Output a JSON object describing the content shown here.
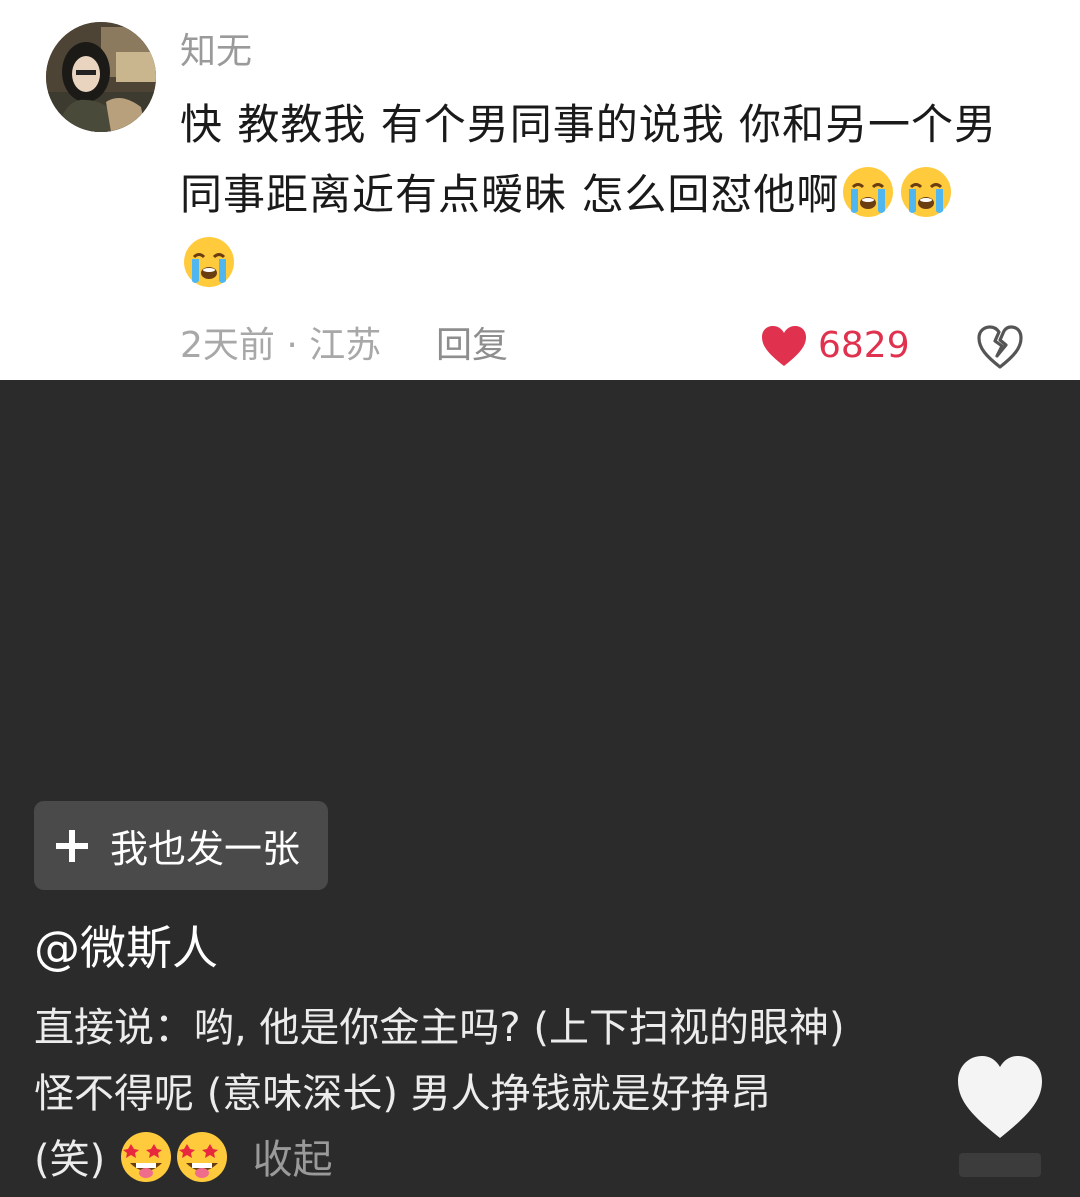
{
  "comment": {
    "username": "知无",
    "text_line1": "快 教教我 有个男同事的说我 你和另一个男",
    "text_line2": "同事距离近有点暧昧 怎么回怼他啊",
    "emoji": "loudly-crying-face-icon",
    "time_location": "2天前 · 江苏",
    "reply_label": "回复",
    "like_count": "6829",
    "like_color": "#e0314f"
  },
  "post": {
    "add_button_label": "我也发一张",
    "author": "@微斯人",
    "desc_line1": "直接说：哟, 他是你金主吗? (上下扫视的眼神)",
    "desc_line2": "怪不得呢 (意味深长) 男人挣钱就是好挣昂",
    "desc_line3": "(笑)",
    "desc_emoji": "star-struck-face-icon",
    "collapse_label": "收起"
  }
}
